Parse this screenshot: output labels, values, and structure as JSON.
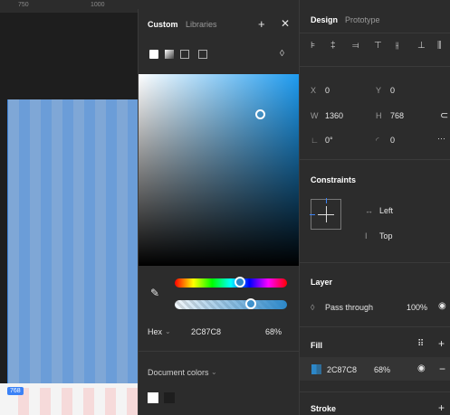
{
  "canvas": {
    "ruler_ticks": [
      "750",
      "1000"
    ],
    "frame_size_badge": "768"
  },
  "picker": {
    "tabs": {
      "custom": "Custom",
      "libraries": "Libraries"
    },
    "add_icon": "+",
    "close_icon": "✕",
    "paint_types": [
      "solid-paint-icon",
      "gradient-paint-icon",
      "image-paint-icon",
      "video-paint-icon"
    ],
    "blend_icon": "◊",
    "color_format": "Hex",
    "hex": "2C87C8",
    "opacity": "68%",
    "selected_color": "#2C87C8",
    "hue_fraction": 0.58,
    "alpha_fraction": 0.68,
    "document_colors_label": "Document colors",
    "document_colors": [
      "#FFFFFF",
      "#1E1E1E"
    ]
  },
  "panel": {
    "tabs": {
      "design": "Design",
      "prototype": "Prototype"
    },
    "position": {
      "x_label": "X",
      "x": "0",
      "y_label": "Y",
      "y": "0"
    },
    "size": {
      "w_label": "W",
      "w": "1360",
      "h_label": "H",
      "h": "768"
    },
    "rotation": {
      "label": "∟",
      "value": "0°"
    },
    "corner": {
      "label": "◜",
      "value": "0"
    },
    "more": "···",
    "constraints": {
      "title": "Constraints",
      "horizontal": "Left",
      "vertical": "Top"
    },
    "layer": {
      "title": "Layer",
      "blend": "Pass through",
      "opacity": "100%"
    },
    "fill": {
      "title": "Fill",
      "hex": "2C87C8",
      "opacity": "68%"
    },
    "stroke": {
      "title": "Stroke"
    }
  }
}
